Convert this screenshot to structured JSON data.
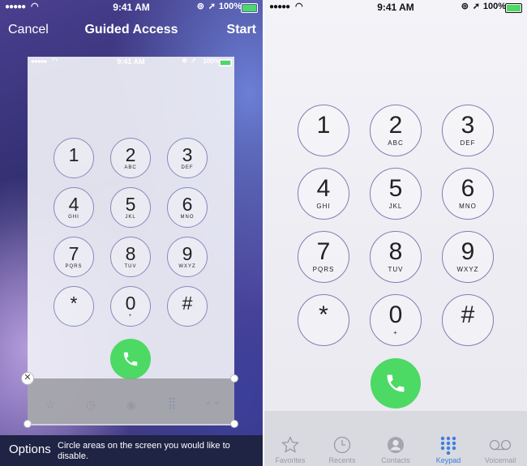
{
  "left_panel": {
    "status_bar": {
      "signal": "●●●●●",
      "time": "9:41 AM",
      "battery": "100%"
    },
    "header": {
      "cancel_label": "Cancel",
      "title": "Guided Access",
      "start_label": "Start"
    },
    "inset_status_bar": {
      "signal": "●●●●●",
      "time": "9:41 AM",
      "battery": "100%"
    },
    "footer": {
      "options_label": "Options",
      "hint": "Circle areas on the screen you would like to disable."
    }
  },
  "right_panel": {
    "status_bar": {
      "signal": "●●●●●",
      "time": "9:41 AM",
      "battery": "100%"
    },
    "tabs": [
      {
        "label": "Favorites",
        "icon": "star-icon"
      },
      {
        "label": "Recents",
        "icon": "clock-icon"
      },
      {
        "label": "Contacts",
        "icon": "person-icon"
      },
      {
        "label": "Keypad",
        "icon": "keypad-icon"
      },
      {
        "label": "Voicemail",
        "icon": "voicemail-icon"
      }
    ]
  },
  "keypad": [
    {
      "digit": "1",
      "letters": ""
    },
    {
      "digit": "2",
      "letters": "ABC"
    },
    {
      "digit": "3",
      "letters": "DEF"
    },
    {
      "digit": "4",
      "letters": "GHI"
    },
    {
      "digit": "5",
      "letters": "JKL"
    },
    {
      "digit": "6",
      "letters": "MNO"
    },
    {
      "digit": "7",
      "letters": "PQRS"
    },
    {
      "digit": "8",
      "letters": "TUV"
    },
    {
      "digit": "9",
      "letters": "WXYZ"
    },
    {
      "digit": "*",
      "letters": ""
    },
    {
      "digit": "0",
      "letters": "+"
    },
    {
      "digit": "#",
      "letters": ""
    }
  ],
  "colors": {
    "call_green": "#4cd964",
    "active_tab": "#3a7fe0",
    "footer_bg": "#1f2344"
  }
}
